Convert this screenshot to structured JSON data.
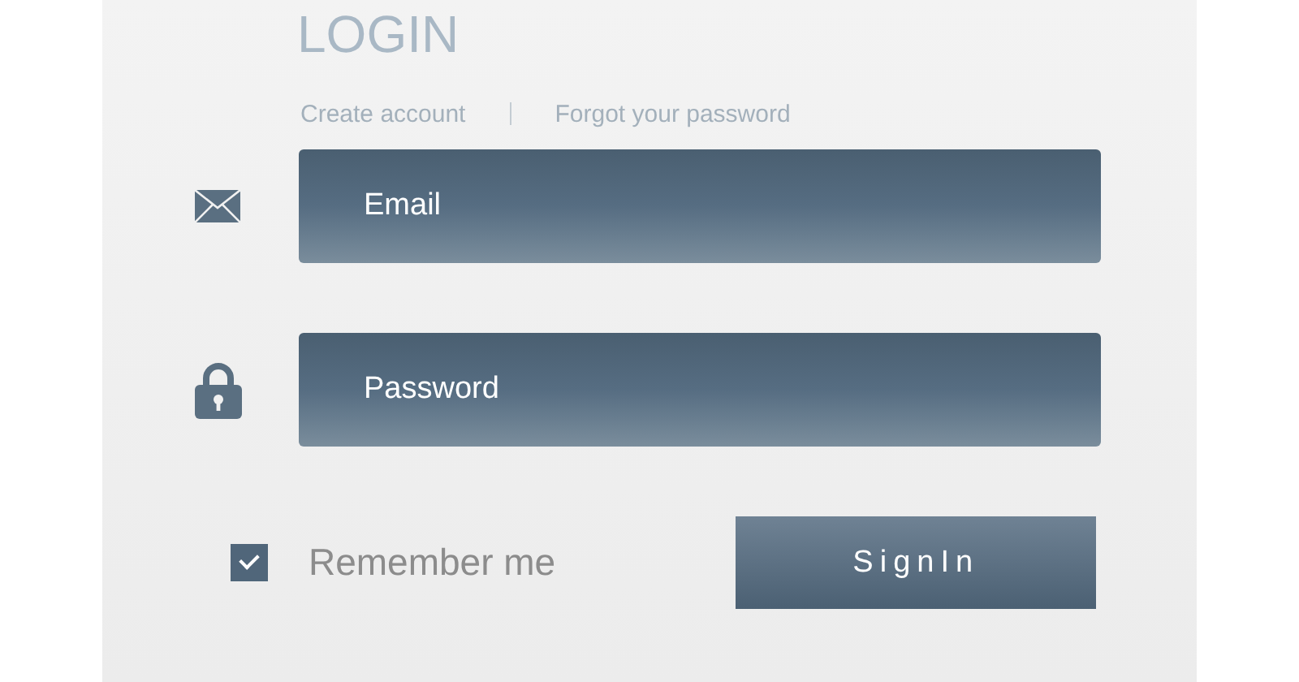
{
  "title": "LOGIN",
  "links": [
    {
      "label": "Create account"
    },
    {
      "label": "Forgot your password"
    }
  ],
  "fields": [
    {
      "kind": "email",
      "placeholder": "Email"
    },
    {
      "kind": "password",
      "placeholder": "Password"
    }
  ],
  "remember": {
    "label": "Remember me",
    "checked": true
  },
  "submit": {
    "label": "SignIn"
  }
}
